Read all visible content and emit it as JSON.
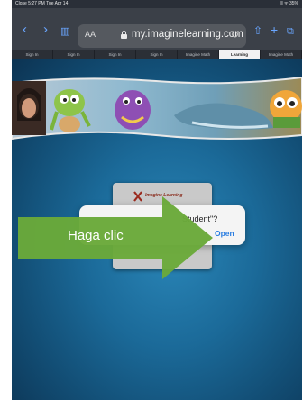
{
  "status_bar": {
    "time": "Close  5:27 PM  Tue Apr 14",
    "indicators": "ıll ᯤ 35%"
  },
  "browser": {
    "aa_label": "AA",
    "url": "my.imaginelearning.com",
    "tabs": [
      "Sign In",
      "Sign In",
      "Sign In",
      "Sign In",
      "Imagine Math",
      "Learning",
      "Imagine Math"
    ],
    "active_tab_index": 5
  },
  "page": {
    "logo_text": "Imagine Learning",
    "dialog": {
      "message": "Student\"?",
      "open_label": "Open"
    },
    "callout": {
      "label": "Haga clic",
      "color": "#6aa93a"
    }
  }
}
